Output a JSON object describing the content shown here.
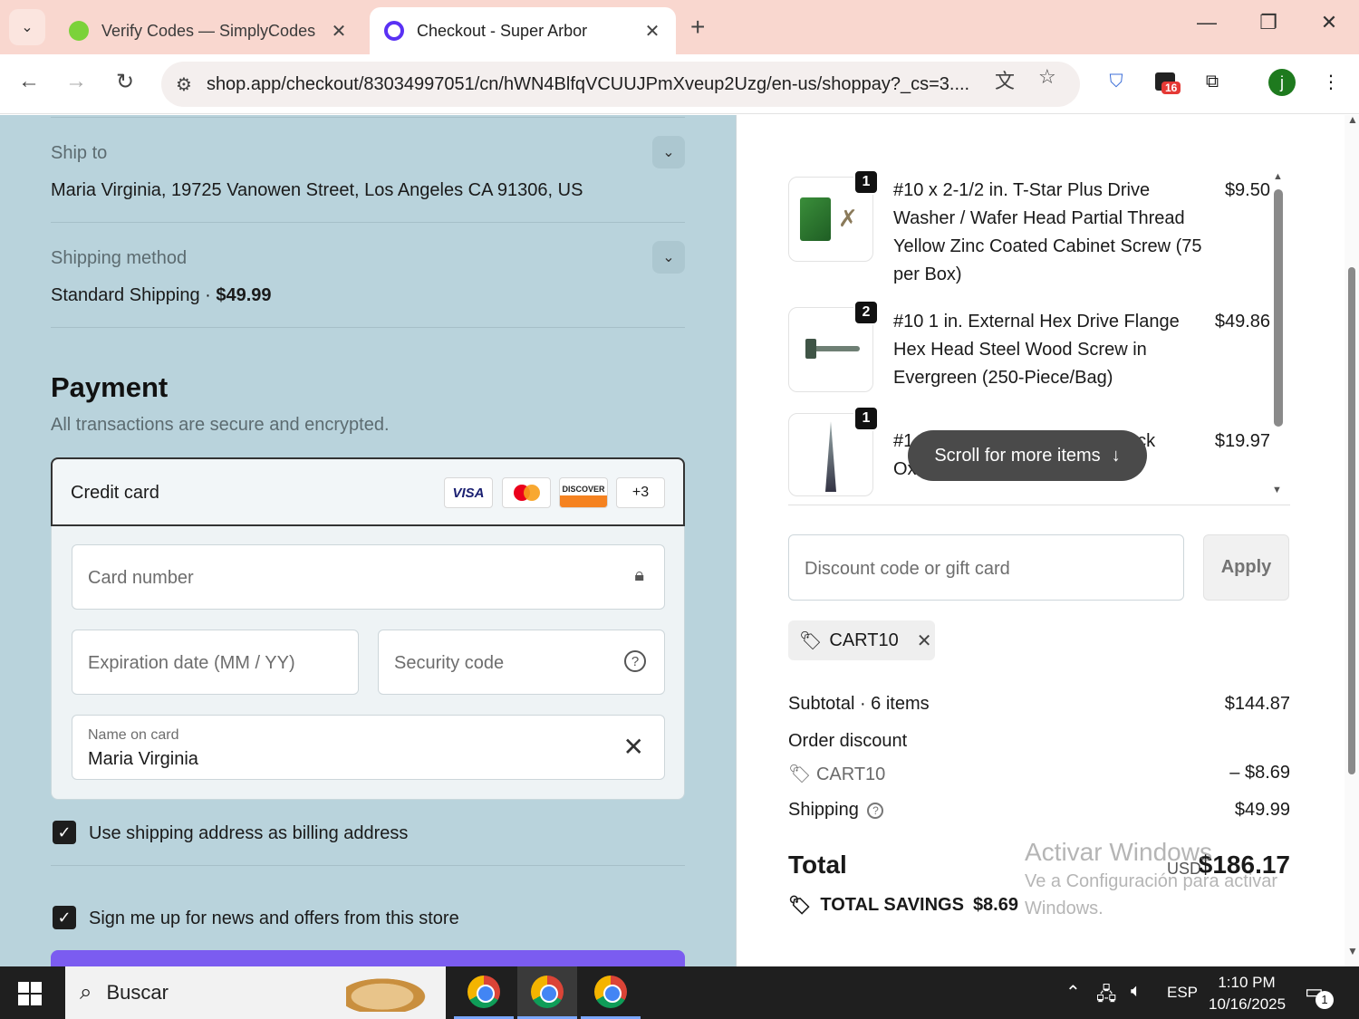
{
  "browser": {
    "tabs": [
      {
        "title": "Verify Codes — SimplyCodes",
        "active": false
      },
      {
        "title": "Checkout - Super Arbor",
        "active": true
      }
    ],
    "url": "shop.app/checkout/83034997051/cn/hWN4BlfqVCUUJPmXveup2Uzg/en-us/shoppay?_cs=3....",
    "ext_badge": "16",
    "profile_initial": "j"
  },
  "left": {
    "ship_to_label": "Ship to",
    "ship_to_value": "Maria Virginia, 19725 Vanowen Street, Los Angeles CA 91306, US",
    "shipping_method_label": "Shipping method",
    "shipping_method_name": "Standard Shipping · ",
    "shipping_method_price": "$49.99",
    "payment_title": "Payment",
    "payment_subtitle": "All transactions are secure and encrypted.",
    "credit_card_label": "Credit card",
    "card_logos": [
      "VISA",
      "mastercard",
      "DISCOVER"
    ],
    "more_cards": "+3",
    "card_number_placeholder": "Card number",
    "expiration_placeholder": "Expiration date (MM / YY)",
    "security_code_placeholder": "Security code",
    "name_on_card_label": "Name on card",
    "name_on_card_value": "Maria Virginia",
    "billing_checkbox_label": "Use shipping address as billing address",
    "news_checkbox_label": "Sign me up for news and offers from this store"
  },
  "right": {
    "items": [
      {
        "qty": "1",
        "name": "#10 x 2-1/2 in. T-Star Plus Drive Washer / Wafer Head Partial Thread Yellow Zinc Coated Cabinet Screw (75 per Box)",
        "price": "$9.50"
      },
      {
        "qty": "2",
        "name": "#10 1 in. External Hex Drive Flange Hex Head Steel Wood Screw in Evergreen (250-Piece/Bag)",
        "price": "$49.86"
      },
      {
        "qty": "1",
        "name_start": "#1",
        "name_start_2": "Ox",
        "name_end": "ack",
        "price": "$19.97"
      }
    ],
    "scroll_hint": "Scroll for more items",
    "discount_placeholder": "Discount code or gift card",
    "apply_label": "Apply",
    "applied_code": "CART10",
    "subtotal_label": "Subtotal · 6 items",
    "subtotal_value": "$144.87",
    "order_discount_label": "Order discount",
    "discount_code": "CART10",
    "discount_value": "– $8.69",
    "shipping_label": "Shipping",
    "shipping_value": "$49.99",
    "total_label": "Total",
    "total_currency": "USD",
    "total_value": "$186.17",
    "savings_label": "TOTAL SAVINGS",
    "savings_value": "$8.69"
  },
  "watermark": {
    "title": "Activar Windows",
    "subtitle_1": "Ve a Configuración para activar",
    "subtitle_2": "Windows."
  },
  "taskbar": {
    "search_placeholder": "Buscar",
    "language": "ESP",
    "time": "1:10 PM",
    "date": "10/16/2025",
    "notification_count": "1"
  }
}
